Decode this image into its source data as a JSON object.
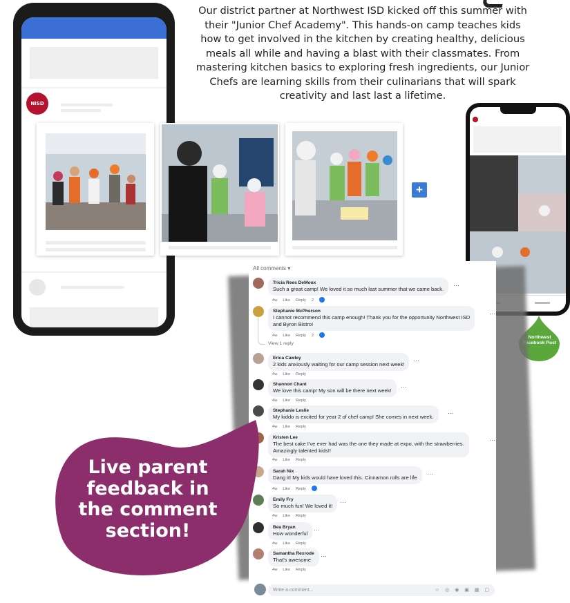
{
  "intro": "Our district partner at Northwest ISD kicked off this summer with their \"Junior Chef Academy\". This hands-on camp teaches kids how to get involved in the kitchen by creating healthy, delicious meals all while and having a blast with their classmates. From mastering kitchen basics to exploring fresh ingredients, our Junior Chefs are learning skills from their culinarians that will spark creativity and last last a lifetime.",
  "logo_text": "NISD",
  "plus_symbol": "+",
  "colors": {
    "brand_blue": "#3b6fd6",
    "accent_purple": "#8b2e6b",
    "accent_green": "#5aa83c",
    "logo_red": "#b5122f"
  },
  "fb_post_caption": "Northwest Facebook Post",
  "comments_panel": {
    "all_comments_label": "All comments",
    "view_reply": "View 1 reply",
    "write_placeholder": "Write a comment...",
    "actions": {
      "time": "4w",
      "like": "Like",
      "reply": "Reply"
    },
    "comments": [
      {
        "name": "Tricia Rees DeMoux",
        "text": "Such a great camp! We loved it so much last summer that we came back.",
        "reactions": "2"
      },
      {
        "name": "Stephanie McPherson",
        "text": "I cannot recommend this camp enough! Thank you for the opportunity Northwest ISD",
        "text2": "and Byron Bistro!",
        "reactions": "2"
      },
      {
        "name": "Erica Cawley",
        "text": "2 kids anxiously waiting for our camp session next week!"
      },
      {
        "name": "Shannon Chant",
        "text": "We love this camp! My son will be there next week!"
      },
      {
        "name": "Stephanie Leslie",
        "text": "My kiddo is excited for year 2 of chef camp! She comes in next week."
      },
      {
        "name": "Kristen Lee",
        "text": "The best cake I've ever had was the one they made at expo, with the strawberries.",
        "text2": "Amazingly talented kids!!"
      },
      {
        "name": "Sarah Nix",
        "text": "Dang it! My kids would have loved this. Cinnamon rolls are life"
      },
      {
        "name": "Emily Fry",
        "text": "So much fun! We loved it!"
      },
      {
        "name": "Bea Bryan",
        "text": "How wonderful"
      },
      {
        "name": "Samantha Rexrode",
        "text": "That's awesome"
      }
    ]
  },
  "callout": "Live parent feedback in the comment section!"
}
